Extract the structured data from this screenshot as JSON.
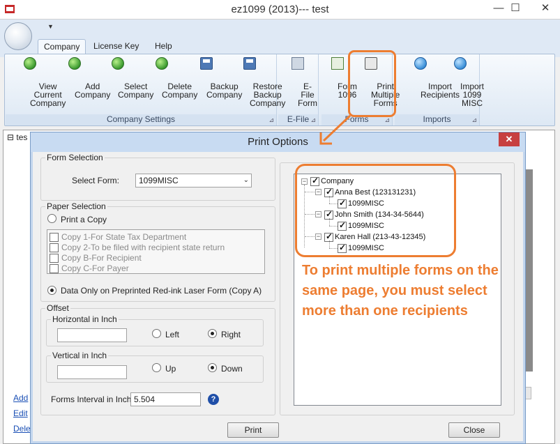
{
  "window": {
    "title": "ez1099 (2013)--- test",
    "minimize": "—",
    "restore": "☐",
    "close": "✕"
  },
  "ribbon": {
    "tabs": [
      "Company",
      "License Key",
      "Help"
    ],
    "buttons": {
      "view_current_company": "View\nCurrent\nCompany",
      "add_company": "Add\nCompany",
      "select_company": "Select\nCompany",
      "delete_company": "Delete\nCompany",
      "backup_company": "Backup\nCompany",
      "restore_backup_company": "Restore\nBackup\nCompany",
      "efile_form": "E-File\nForm",
      "form_1096": "Form\n1096",
      "print_multiple_forms": "Print\nMultiple\nForms",
      "import_recipients": "Import\nRecipients",
      "import_1099_misc": "Import\n1099\nMISC"
    },
    "groups": {
      "company_settings": "Company Settings",
      "efile": "E-File",
      "forms": "Forms",
      "imports": "Imports"
    }
  },
  "background": {
    "tree_root": "⊟ tes",
    "links": [
      "Add",
      "Edit",
      "Dele"
    ]
  },
  "dialog": {
    "title": "Print Options",
    "close": "✕",
    "form_selection": {
      "legend": "Form Selection",
      "select_label": "Select Form:",
      "selected": "1099MISC"
    },
    "paper_selection": {
      "legend": "Paper Selection",
      "print_a_copy": "Print a Copy",
      "copies": [
        "Copy 1-For State Tax Department",
        "Copy 2-To be filed with recipient state return",
        "Copy B-For Recipient",
        "Copy C-For Payer"
      ],
      "data_only": "Data Only on Preprinted Red-ink Laser Form (Copy A)"
    },
    "offset": {
      "legend": "Offset",
      "horizontal_legend": "Horizontal in Inch",
      "horizontal_value": "",
      "left": "Left",
      "right": "Right",
      "vertical_legend": "Vertical in Inch",
      "vertical_value": "",
      "up": "Up",
      "down": "Down"
    },
    "forms_interval_label": "Forms Interval in Inch:",
    "forms_interval_value": "5.504",
    "help": "?",
    "print_button": "Print",
    "close_button": "Close",
    "tree": {
      "root": "Company",
      "recipients": [
        {
          "name": "Anna Best (123131231)",
          "form": "1099MISC"
        },
        {
          "name": "John Smith (134-34-5644)",
          "form": "1099MISC"
        },
        {
          "name": "Karen Hall (213-43-12345)",
          "form": "1099MISC"
        }
      ]
    }
  },
  "annotation": {
    "text": "To print multiple forms on the same page, you must select more than one recipients",
    "color": "#ed7d31"
  }
}
